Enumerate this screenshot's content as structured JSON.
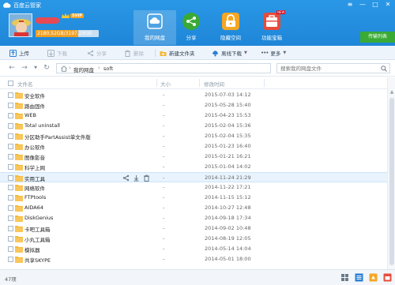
{
  "window": {
    "title": "百度云管家",
    "min_glyph": "—",
    "max_glyph": "□",
    "close_glyph": "✕",
    "menu_glyph": "≡"
  },
  "user": {
    "vip_label": "SVIP",
    "quota_text": "2180.52GB/3197.29GB",
    "quota_fraction": 0.68
  },
  "nav": {
    "tabs": [
      {
        "label": "我的网盘",
        "active": true
      },
      {
        "label": "分享",
        "active": false
      },
      {
        "label": "隐藏空间",
        "active": false
      },
      {
        "label": "功能宝箱",
        "active": false,
        "badge": "NEW"
      }
    ],
    "sync_list": "传输列表"
  },
  "toolbar": {
    "upload": "上传",
    "download": "下载",
    "share": "分享",
    "delete": "删除",
    "new_folder": "新建文件夹",
    "offline_download": "离线下载",
    "more": "更多"
  },
  "address": {
    "crumbs": [
      "我的网盘",
      "soft"
    ],
    "search_placeholder": "搜索我的网盘文件"
  },
  "columns": {
    "name": "文件名",
    "size": "大小",
    "modified": "修改时间"
  },
  "files": [
    {
      "name": "安全软件",
      "size": "-",
      "modified": "2015-07-03 14:12"
    },
    {
      "name": "路由固件",
      "size": "-",
      "modified": "2015-05-28 15:40"
    },
    {
      "name": "WEB",
      "size": "-",
      "modified": "2015-04-23 15:53"
    },
    {
      "name": "Total uninstall",
      "size": "-",
      "modified": "2015-02-04 15:36"
    },
    {
      "name": "分区助手PartAssist单文件版",
      "size": "-",
      "modified": "2015-02-04 15:35"
    },
    {
      "name": "办公软件",
      "size": "-",
      "modified": "2015-01-23 16:40"
    },
    {
      "name": "图像影音",
      "size": "-",
      "modified": "2015-01-21 16:21"
    },
    {
      "name": "科学上网",
      "size": "-",
      "modified": "2015-01-04 14:02"
    },
    {
      "name": "实用工具",
      "size": "-",
      "modified": "2014-11-24 21:29",
      "hover": true
    },
    {
      "name": "网络软件",
      "size": "-",
      "modified": "2014-11-22 17:21"
    },
    {
      "name": "FTPtools",
      "size": "-",
      "modified": "2014-11-15 15:12"
    },
    {
      "name": "AIDA64",
      "size": "-",
      "modified": "2014-10-27 12:48"
    },
    {
      "name": "DiskGenius",
      "size": "-",
      "modified": "2014-09-18 17:34"
    },
    {
      "name": "卡吧工具箱",
      "size": "-",
      "modified": "2014-09-02 10:48"
    },
    {
      "name": "小丸工具箱",
      "size": "-",
      "modified": "2014-08-19 12:05"
    },
    {
      "name": "模拟器",
      "size": "-",
      "modified": "2014-05-14 14:04"
    },
    {
      "name": "共享SKYPE",
      "size": "-",
      "modified": "2014-05-01 18:00"
    }
  ],
  "status": {
    "count": "47项"
  },
  "colors": {
    "brand": "#1f86d8",
    "folder": "#f5b93a",
    "green": "#3aaa35",
    "quota": "#f0a024"
  }
}
